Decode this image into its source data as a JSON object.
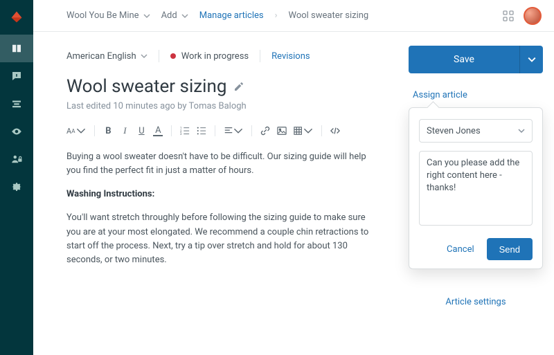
{
  "breadcrumb": {
    "workspace": "Wool You Be Mine",
    "add": "Add",
    "manage": "Manage articles",
    "current": "Wool sweater sizing"
  },
  "editor": {
    "language": "American English",
    "status": "Work in progress",
    "revisions": "Revisions",
    "title": "Wool sweater sizing",
    "last_edited": "Last edited 10 minutes ago by Tomas Balogh",
    "para1": "Buying a wool sweater doesn't have to be difficult. Our sizing guide will help you find the perfect fit in just a matter of hours.",
    "heading2": "Washing Instructions:",
    "para2": "You'll want stretch throughly before following the sizing guide to make sure you are at your most elongated. We recommend a couple chin retractions to start off the process. Next, try a tip over stretch and hold for about 130 seconds, or two minutes."
  },
  "side": {
    "save": "Save",
    "assign": "Assign article",
    "assignee": "Steven Jones",
    "message": "Can you please add the right content here - thanks!",
    "cancel": "Cancel",
    "send": "Send",
    "settings": "Article settings"
  }
}
